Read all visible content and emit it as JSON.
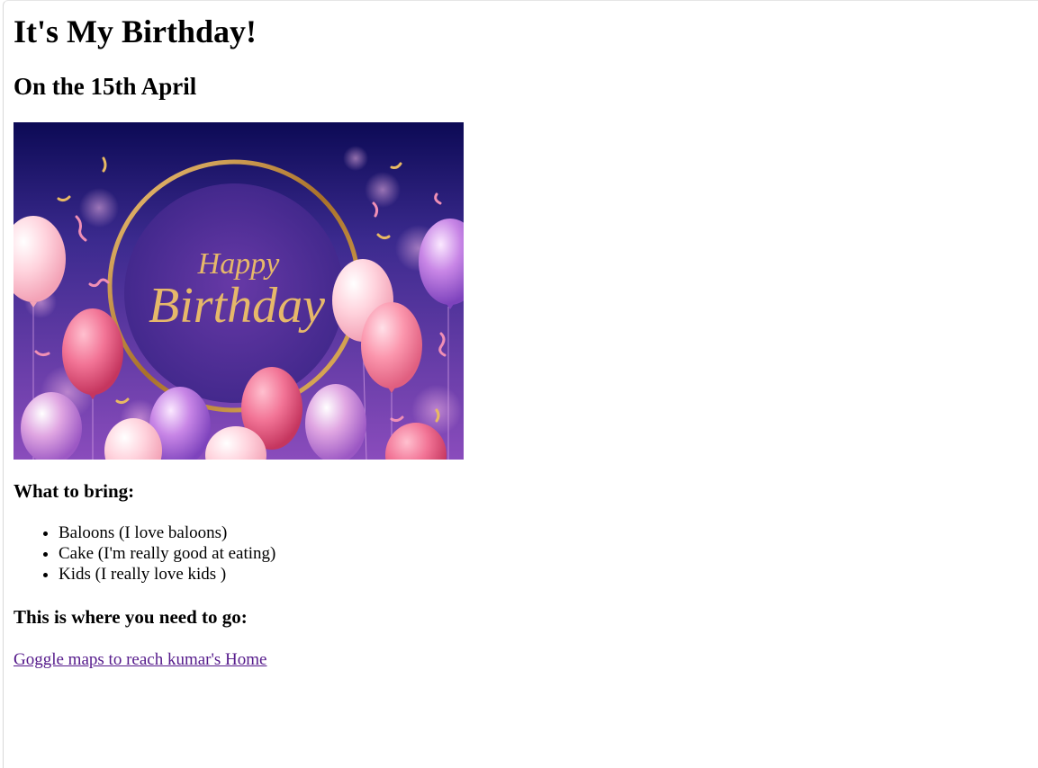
{
  "page": {
    "title": "It's My Birthday!",
    "date_heading": "On the 15th April"
  },
  "banner": {
    "alt": "Happy Birthday",
    "text_line1": "Happy",
    "text_line2": "Birthday",
    "colors": {
      "bg_top": "#0c0a55",
      "bg_bottom": "#7b3fb0",
      "ring": "#c8913a",
      "script_text": "#e6b86a"
    }
  },
  "bring": {
    "heading": "What to bring:",
    "items": [
      "Baloons (I love baloons)",
      "Cake (I'm really good at eating)",
      "Kids (I really love kids )"
    ]
  },
  "where": {
    "heading": "This is where you need to go:",
    "link_text": "Goggle maps to reach kumar's Home"
  }
}
